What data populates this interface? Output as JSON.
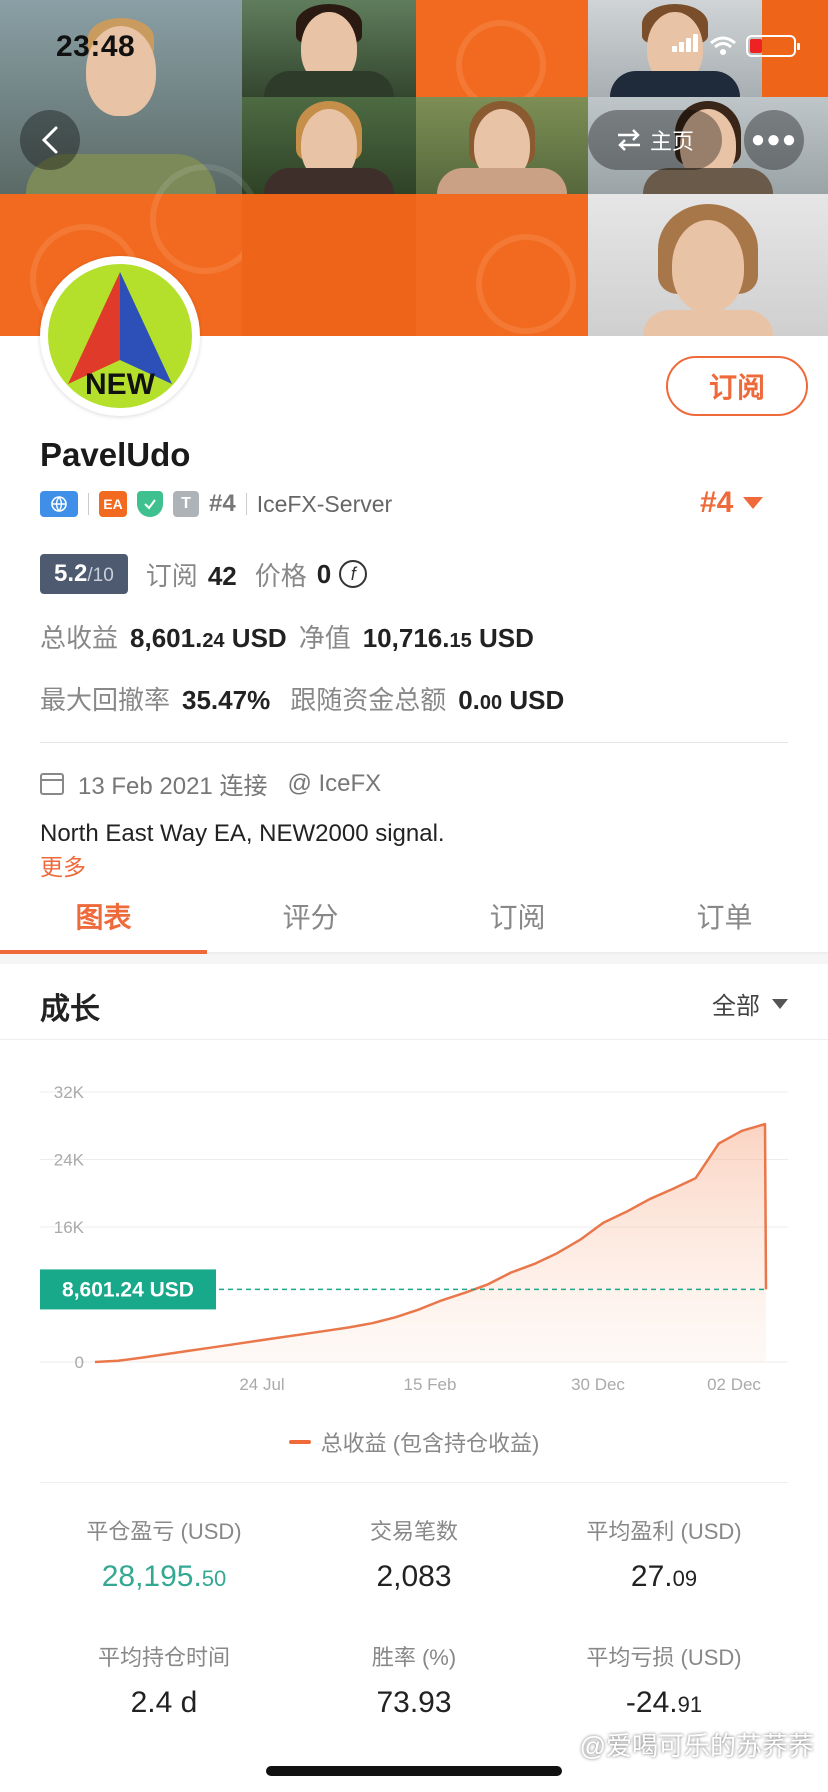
{
  "status_bar": {
    "time": "23:48"
  },
  "header": {
    "back_icon": "chevron-left-icon",
    "home_label": "主页",
    "home_icon": "swap-icon",
    "more_icon": "ellipsis-icon"
  },
  "profile": {
    "avatar_text": "NEW",
    "subscribe_label": "订阅",
    "name": "PavelUdo",
    "badge_ea": "EA",
    "badge_t": "T",
    "rank_small": "#4",
    "server": "IceFX-Server",
    "rank_big": "#4",
    "score_main": "5.2",
    "score_max": "/10",
    "subscribe_count_label": "订阅",
    "subscribe_count": "42",
    "price_label": "价格",
    "price": "0",
    "total_profit_label": "总收益",
    "total_profit_int": "8,601.",
    "total_profit_dec": "24",
    "total_profit_unit": "USD",
    "equity_label": "净值",
    "equity_int": "10,716.",
    "equity_dec": "15",
    "equity_unit": "USD",
    "drawdown_label": "最大回撤率",
    "drawdown": "35.47%",
    "follow_label": "跟随资金总额",
    "follow_int": "0.",
    "follow_dec": "00",
    "follow_unit": "USD",
    "connected_date": "13 Feb 2021 连接",
    "broker": "@ IceFX",
    "description": "North East Way EA, NEW2000 signal.",
    "more_label": "更多"
  },
  "tabs": [
    {
      "label": "图表",
      "active": true
    },
    {
      "label": "评分",
      "active": false
    },
    {
      "label": "订阅",
      "active": false
    },
    {
      "label": "订单",
      "active": false
    }
  ],
  "section": {
    "title": "成长",
    "range": "全部"
  },
  "chart_data": {
    "type": "area",
    "y_ticks": [
      "32K",
      "24K",
      "16K",
      "0"
    ],
    "x_ticks": [
      "24 Jul",
      "15 Feb",
      "30 Dec",
      "02 Dec"
    ],
    "ylim": [
      0,
      32000
    ],
    "current_value_label": "8,601.24 USD",
    "current_value": 8601.24,
    "legend": "总收益 (包含持仓收益)",
    "series": [
      {
        "name": "总收益 (包含持仓收益)",
        "values": [
          0,
          150,
          500,
          900,
          1300,
          1700,
          2100,
          2500,
          2900,
          3300,
          3700,
          4100,
          4600,
          5300,
          6200,
          7300,
          8200,
          9200,
          10600,
          11600,
          12900,
          14500,
          16500,
          17800,
          19300,
          20500,
          21800,
          25900,
          27400,
          28195.5,
          8601.24
        ]
      }
    ]
  },
  "stats": [
    {
      "label": "平仓盈亏 (USD)",
      "int": "28,195.",
      "dec": "50",
      "green": true
    },
    {
      "label": "交易笔数",
      "int": "2,083",
      "dec": ""
    },
    {
      "label": "平均盈利 (USD)",
      "int": "27.",
      "dec": "09"
    },
    {
      "label": "平均持仓时间",
      "int": "2.4 d",
      "dec": ""
    },
    {
      "label": "胜率 (%)",
      "int": "73.93",
      "dec": ""
    },
    {
      "label": "平均亏损 (USD)",
      "int": "-24.",
      "dec": "91"
    }
  ],
  "watermark": "@爱喝可乐的苏荞荞",
  "colors": {
    "accent": "#ef6a3b",
    "green": "#34a892",
    "score_bg": "#4d5a70",
    "banner_orange": "#f26a1f"
  }
}
